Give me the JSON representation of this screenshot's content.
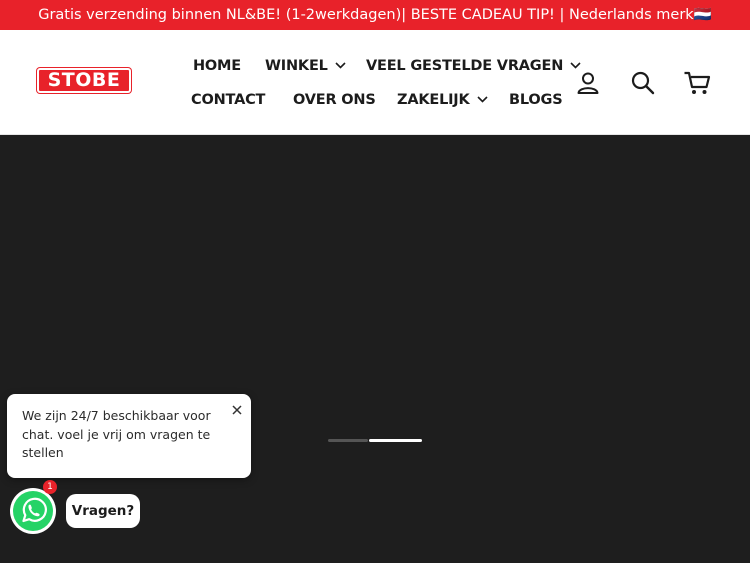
{
  "announcement": {
    "text": "Gratis verzending binnen NL&BE! (1-2werkdagen)| BESTE CADEAU TIP! | Nederlands merk🇳🇱"
  },
  "brand": {
    "logo_text": "STOBE",
    "accent_color": "#e8222a"
  },
  "nav": {
    "home": "HOME",
    "winkel": "WINKEL",
    "faq": "VEEL GESTELDE VRAGEN",
    "contact": "CONTACT",
    "over_ons": "OVER ONS",
    "zakelijk": "ZAKELIJK",
    "blogs": "BLOGS"
  },
  "header_icons": [
    "user-icon",
    "search-icon",
    "cart-icon"
  ],
  "chat": {
    "message": "We zijn 24/7 beschikbaar voor chat. voel je vrij om vragen te stellen",
    "badge_count": "1",
    "button_label": "Vragen?",
    "whatsapp_color": "#25d366"
  },
  "slideshow": {
    "slide_count": 2,
    "active_slide": 2
  }
}
